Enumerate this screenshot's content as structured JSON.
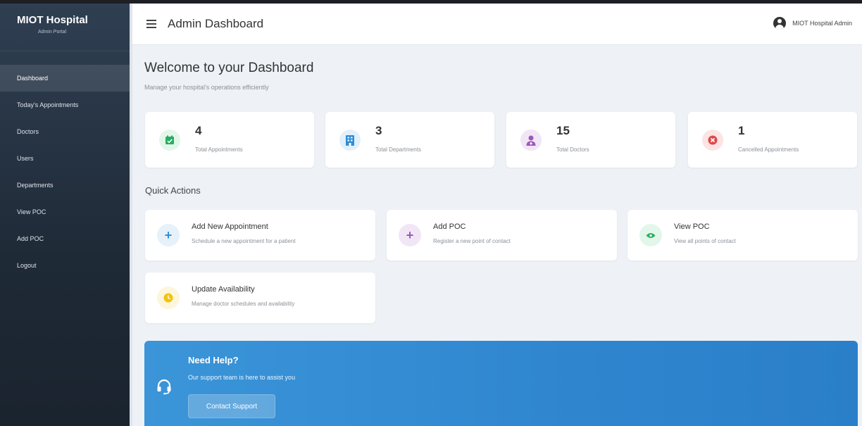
{
  "brand": {
    "title": "MIOT Hospital",
    "subtitle": "Admin Portal"
  },
  "nav": [
    {
      "label": "Dashboard",
      "active": true
    },
    {
      "label": "Today's Appointments"
    },
    {
      "label": "Doctors"
    },
    {
      "label": "Users"
    },
    {
      "label": "Departments"
    },
    {
      "label": "View POC"
    },
    {
      "label": "Add POC"
    },
    {
      "label": "Logout"
    }
  ],
  "header": {
    "title": "Admin Dashboard",
    "user": "MIOT Hospital Admin"
  },
  "welcome": {
    "title": "Welcome to your Dashboard",
    "subtitle": "Manage your hospital's operations efficiently"
  },
  "stats": [
    {
      "value": "4",
      "label": "Total Appointments",
      "icon": "calendar-check-icon",
      "color": "#27ae60",
      "bg": "#e3f6ea"
    },
    {
      "value": "3",
      "label": "Total Departments",
      "icon": "building-icon",
      "color": "#2e8fd6",
      "bg": "#e2f0fb"
    },
    {
      "value": "15",
      "label": "Total Doctors",
      "icon": "doctor-icon",
      "color": "#9b59b6",
      "bg": "#f1e6f6"
    },
    {
      "value": "1",
      "label": "Cancelled Appointments",
      "icon": "cancel-circle-icon",
      "color": "#e04848",
      "bg": "#fbe4e4"
    }
  ],
  "quick_actions": {
    "title": "Quick Actions",
    "items": [
      {
        "name": "Add New Appointment",
        "desc": "Schedule a new appointment for a patient",
        "icon": "plus-icon",
        "color": "#2e8fd6",
        "bg": "#e6f1fa"
      },
      {
        "name": "Add POC",
        "desc": "Register a new point of contact",
        "icon": "plus-icon",
        "color": "#9b59b6",
        "bg": "#f1e6f6"
      },
      {
        "name": "View POC",
        "desc": "View all points of contact",
        "icon": "eye-icon",
        "color": "#27ae60",
        "bg": "#e3f6ea"
      },
      {
        "name": "Update Availability",
        "desc": "Manage doctor schedules and availability",
        "icon": "clock-icon",
        "color": "#f1c40f",
        "bg": "#fdf6dc"
      }
    ]
  },
  "help": {
    "title": "Need Help?",
    "desc": "Our support team is here to assist you",
    "button": "Contact Support",
    "icon": "headset-icon"
  }
}
